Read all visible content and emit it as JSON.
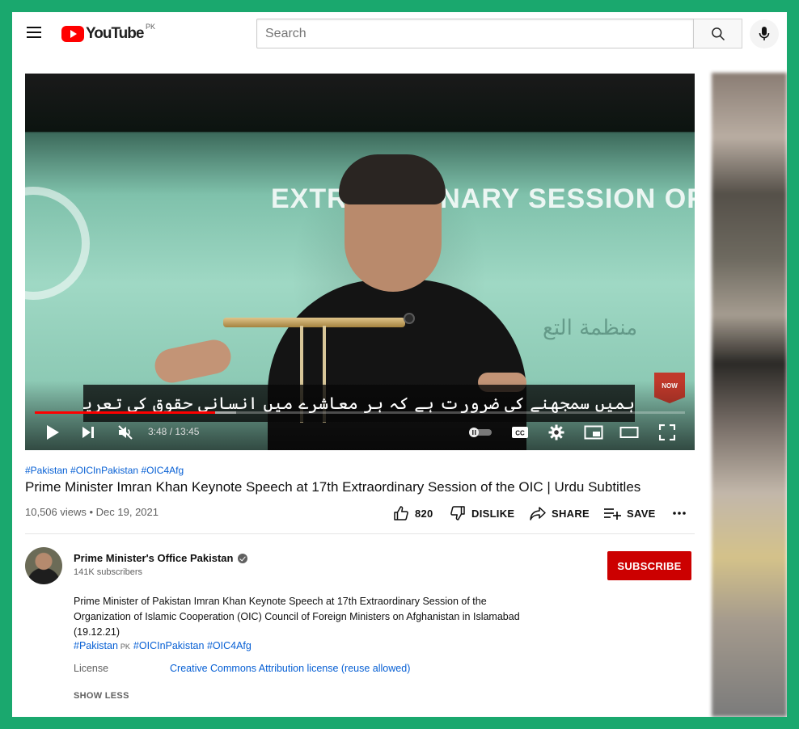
{
  "header": {
    "logo_text": "YouTube",
    "country_code": "PK",
    "search_placeholder": "Search"
  },
  "player": {
    "banner_text": "EXTRAORDINARY SESSION OF TH",
    "banner_arabic": "منظمة التع",
    "badge_text": "NOW",
    "subtitle": "ہمیں سمجھنے کی ضرورت ہے کہ ہر معاشرے میں انسانی حقوق کی تعریف مختلف ہے",
    "time": "3:48 / 13:45",
    "progress": 0.277,
    "buffered": 0.31
  },
  "video": {
    "hashtags": [
      "#Pakistan",
      "#OICInPakistan",
      "#OIC4Afg"
    ],
    "title": "Prime Minister Imran Khan Keynote Speech at 17th Extraordinary Session of the OIC | Urdu Subtitles",
    "views": "10,506 views • Dec 19, 2021",
    "actions": {
      "likes": "820",
      "dislike": "DISLIKE",
      "share": "SHARE",
      "save": "SAVE"
    }
  },
  "channel": {
    "name": "Prime Minister's Office Pakistan",
    "subscribers": "141K subscribers",
    "subscribe_label": "SUBSCRIBE"
  },
  "description": {
    "text": "Prime Minister of Pakistan Imran Khan Keynote Speech at 17th Extraordinary Session of the Organization of Islamic Cooperation (OIC) Council of Foreign Ministers on Afghanistan in Islamabad (19.12.21)",
    "tags": [
      "#Pakistan",
      "#OICInPakistan",
      "#OIC4Afg"
    ],
    "flag_text": "PK",
    "license_label": "License",
    "license_value": "Creative Commons Attribution license (reuse allowed)",
    "show_less": "SHOW LESS"
  },
  "colors": {
    "frame": "#1aa86e",
    "brand_red": "#ff0000",
    "subscribe": "#cc0000",
    "link": "#065fd4"
  }
}
